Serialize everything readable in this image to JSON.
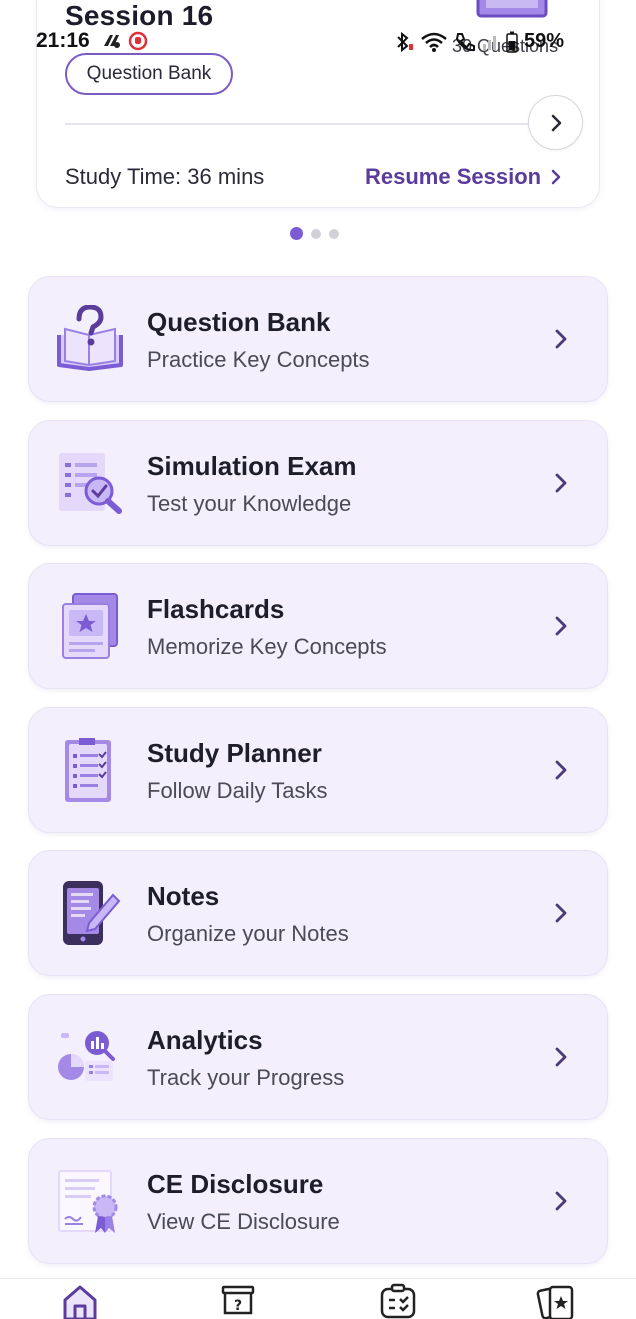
{
  "status_bar": {
    "time": "21:16",
    "battery": "59%"
  },
  "session": {
    "title": "Session 16",
    "questions": "30 Questions",
    "chip": "Question Bank",
    "study_time": "Study Time: 36 mins",
    "resume": "Resume Session"
  },
  "pager": {
    "count": 3,
    "active": 1
  },
  "menu": [
    {
      "title": "Question Bank",
      "subtitle": "Practice Key Concepts",
      "icon": "question-book-icon"
    },
    {
      "title": "Simulation Exam",
      "subtitle": "Test your Knowledge",
      "icon": "exam-magnifier-icon"
    },
    {
      "title": "Flashcards",
      "subtitle": "Memorize Key Concepts",
      "icon": "flashcards-icon"
    },
    {
      "title": "Study Planner",
      "subtitle": "Follow Daily Tasks",
      "icon": "checklist-icon"
    },
    {
      "title": "Notes",
      "subtitle": "Organize your Notes",
      "icon": "phone-pencil-icon"
    },
    {
      "title": "Analytics",
      "subtitle": "Track your Progress",
      "icon": "analytics-chart-icon"
    },
    {
      "title": "CE Disclosure",
      "subtitle": "View CE Disclosure",
      "icon": "certificate-icon"
    }
  ],
  "bottom_nav": [
    {
      "name": "home",
      "icon": "home-icon"
    },
    {
      "name": "question-bank",
      "icon": "question-box-icon"
    },
    {
      "name": "planner",
      "icon": "planner-board-icon"
    },
    {
      "name": "flashcards",
      "icon": "flashcards-star-icon"
    }
  ],
  "colors": {
    "accent": "#7c5cd4",
    "accent_dark": "#5b3c9c",
    "card_bg": "#f3effc"
  }
}
